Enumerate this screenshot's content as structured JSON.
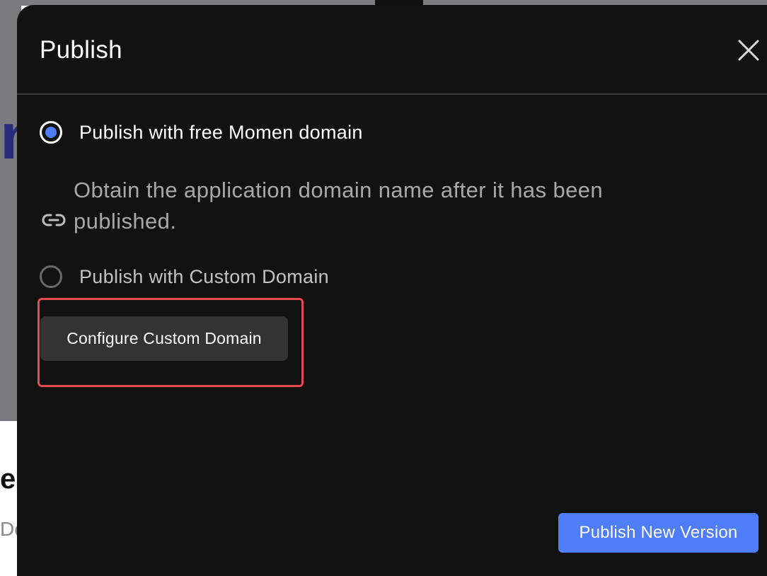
{
  "background": {
    "heading_fragment": "n",
    "subheading_fragment": "e",
    "subtext_fragment": "De"
  },
  "modal": {
    "title": "Publish",
    "close_icon": "close-icon",
    "options": [
      {
        "label": "Publish with free Momen domain",
        "selected": true
      },
      {
        "label": "Publish with Custom Domain",
        "selected": false
      }
    ],
    "free_domain_description": "Obtain the application domain name after it has been published.",
    "link_icon": "link-icon",
    "configure_button_label": "Configure Custom Domain",
    "publish_button_label": "Publish New Version"
  },
  "colors": {
    "accent": "#4f7cf7",
    "modal_bg": "#121212",
    "highlight": "#e5484d",
    "secondary_button": "#333333"
  }
}
